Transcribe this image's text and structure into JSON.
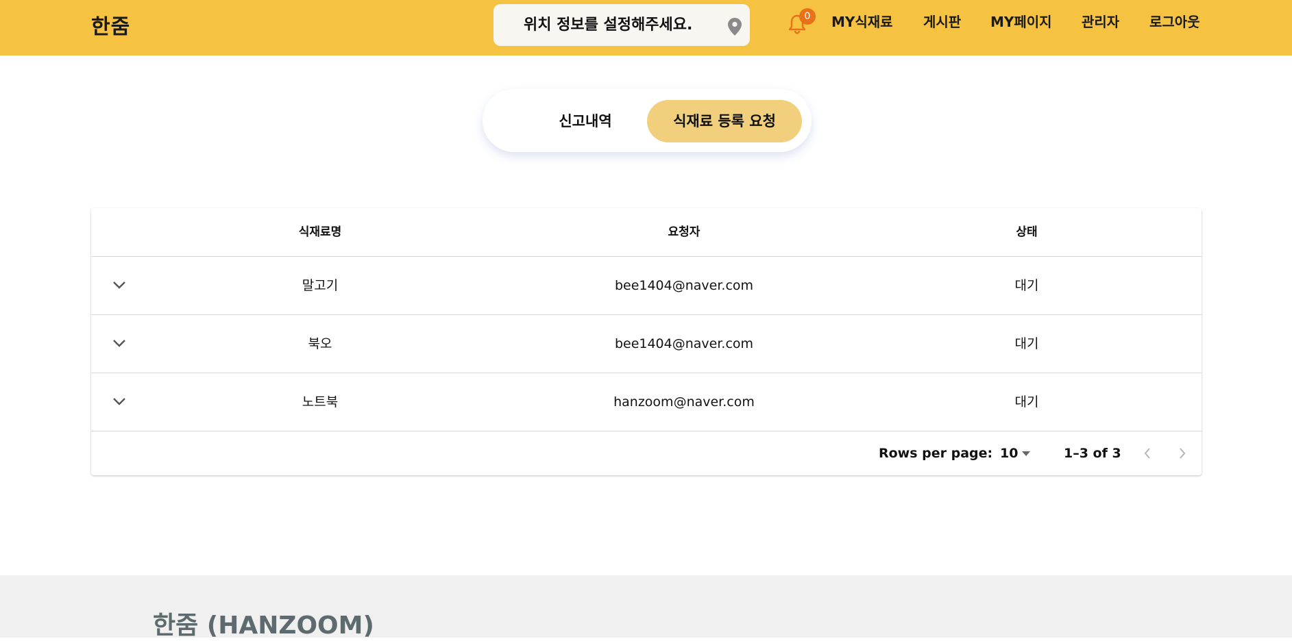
{
  "header": {
    "logo": "한줌",
    "location": "위치 정보를 설정해주세요.",
    "notification_count": "0",
    "nav": [
      "MY식재료",
      "게시판",
      "MY페이지",
      "관리자",
      "로그아웃"
    ]
  },
  "tabs": {
    "report": "신고내역",
    "request": "식재료 등록 요청"
  },
  "table": {
    "headers": [
      "식재료명",
      "요청자",
      "상태"
    ],
    "rows": [
      {
        "name": "말고기",
        "requester": "bee1404@naver.com",
        "status": "대기"
      },
      {
        "name": "북오",
        "requester": "bee1404@naver.com",
        "status": "대기"
      },
      {
        "name": "노트북",
        "requester": "hanzoom@naver.com",
        "status": "대기"
      }
    ],
    "pagination": {
      "rows_per_page_label": "Rows per page:",
      "rows_per_page": "10",
      "range": "1–3 of 3"
    }
  },
  "footer": {
    "brand": "한줌 (HANZOOM)"
  },
  "colors": {
    "header": "#f5c242",
    "active_tab": "#f1cf7c",
    "badge": "#e8711a"
  }
}
